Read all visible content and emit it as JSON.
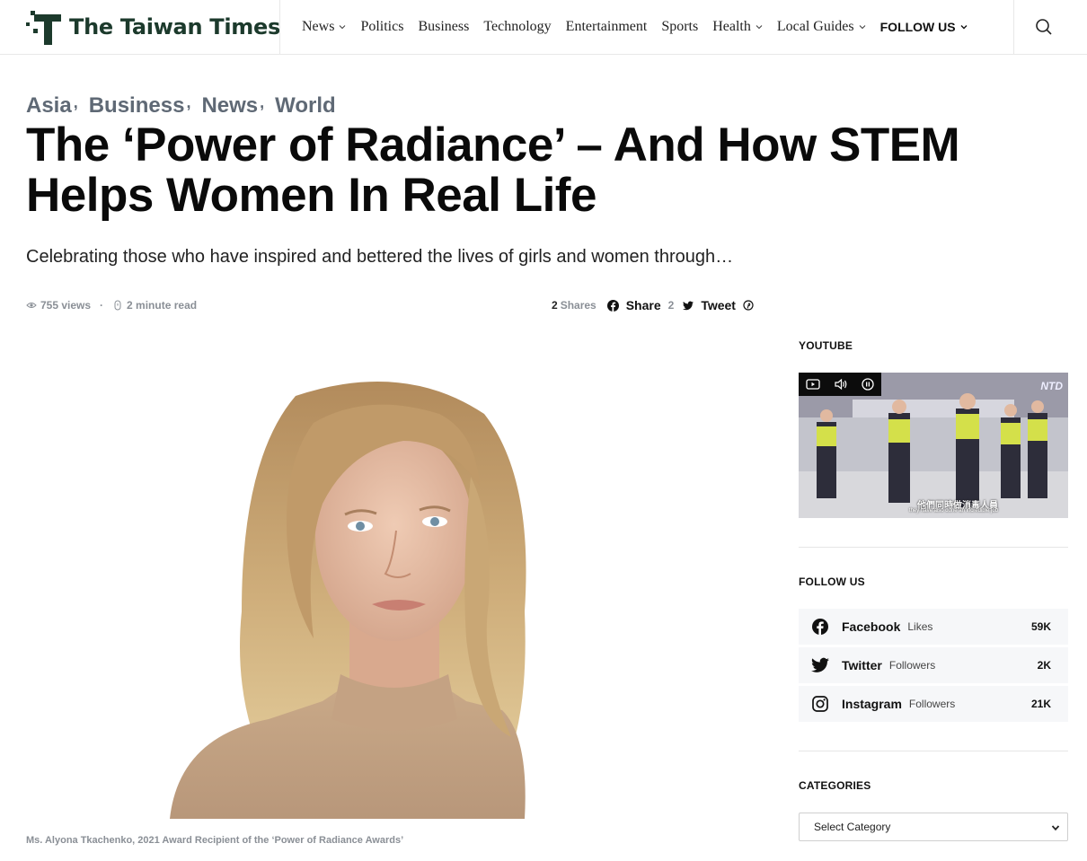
{
  "site": {
    "name": "The Taiwan Times",
    "brand_color": "#1c3a2c"
  },
  "nav": {
    "items": [
      {
        "label": "News",
        "dropdown": true
      },
      {
        "label": "Politics",
        "dropdown": false
      },
      {
        "label": "Business",
        "dropdown": false
      },
      {
        "label": "Technology",
        "dropdown": false
      },
      {
        "label": "Entertainment",
        "dropdown": false
      },
      {
        "label": "Sports",
        "dropdown": false
      },
      {
        "label": "Health",
        "dropdown": true
      },
      {
        "label": "Local Guides",
        "dropdown": true
      }
    ],
    "follow": "FOLLOW US",
    "search_icon": "search-icon"
  },
  "article": {
    "categories": [
      "Asia",
      "Business",
      "News",
      "World"
    ],
    "title": "The ‘Power of Radiance’ – And How STEM Helps Women In Real Life",
    "subtitle": "Celebrating those who have inspired and bettered the lives of girls and women through…",
    "views": "755 views",
    "read_time": "2 minute read",
    "shares_count": "2",
    "shares_label": "Shares",
    "share_label": "Share",
    "share_count": "2",
    "tweet_label": "Tweet",
    "caption": "Ms. Alyona Tkachenko, 2021 Award Recipient of the ‘Power of Radiance Awards’"
  },
  "sidebar": {
    "youtube_heading": "YOUTUBE",
    "video": {
      "watermark": "NTD",
      "subtitle_zh": "他們同時做消毒人員",
      "subtitle_en": "they have also done an incredible job"
    },
    "follow_heading": "FOLLOW US",
    "networks": [
      {
        "name": "Facebook",
        "unit": "Likes",
        "count": "59K"
      },
      {
        "name": "Twitter",
        "unit": "Followers",
        "count": "2K"
      },
      {
        "name": "Instagram",
        "unit": "Followers",
        "count": "21K"
      }
    ],
    "categories_heading": "CATEGORIES",
    "category_select": "Select Category"
  }
}
